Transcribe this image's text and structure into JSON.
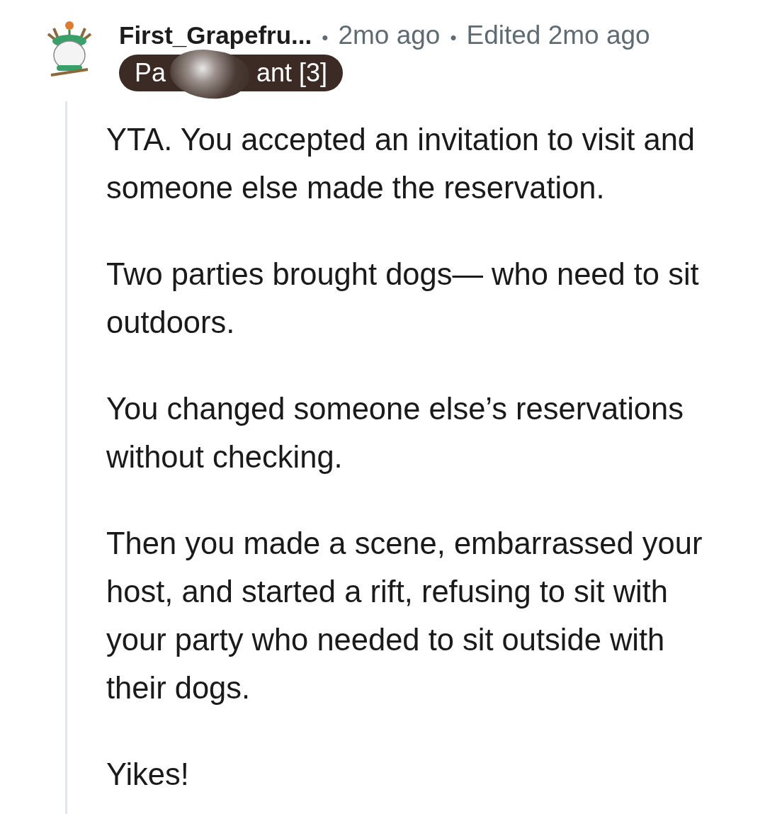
{
  "comment": {
    "author": "First_Grapefru...",
    "separator": "•",
    "time": "2mo ago",
    "edited": "Edited 2mo ago",
    "flair": {
      "parts": [
        "Pa",
        "ant [3]"
      ],
      "redacted": true
    },
    "paragraphs": [
      "YTA. You accepted an invitation to visit and someone else made the reservation.",
      "Two parties brought dogs— who need to sit outdoors.",
      "You changed someone else’s reservations without checking.",
      "Then you made a scene, embarrassed your host, and started a rift, refusing to sit with your party who needed to sit outside with their dogs.",
      "Yikes!"
    ]
  }
}
